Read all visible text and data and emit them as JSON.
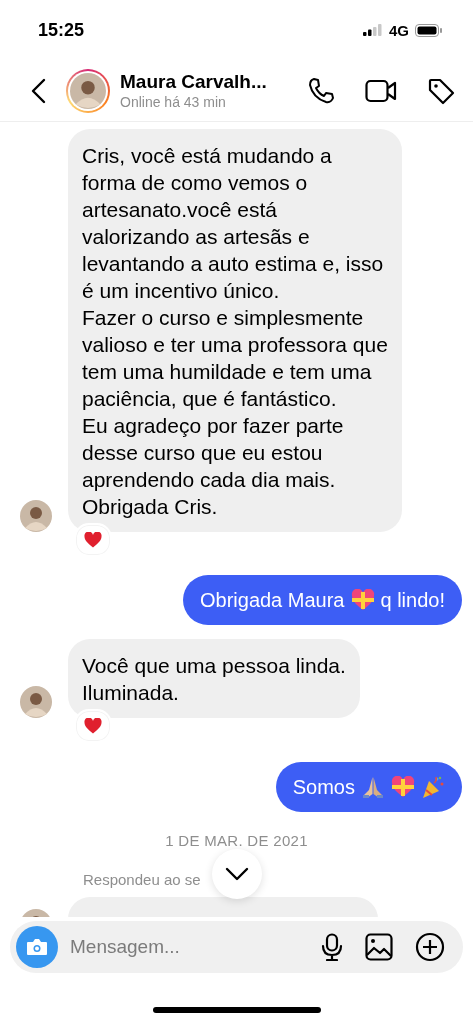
{
  "status_bar": {
    "time": "15:25",
    "network": "4G"
  },
  "header": {
    "name": "Maura Carvalh...",
    "presence": "Online há 43 min"
  },
  "messages": [
    {
      "kind": "incoming",
      "text": "Cris, você está mudando a forma de como vemos o artesanato.você está valorizando as artesãs e levantando a auto estima e, isso é um incentivo único.\nFazer o curso e simplesmente valioso e ter uma professora que tem uma humildade e tem uma paciência, que é fantástico.\nEu agradeço por fazer parte desse curso que eu estou aprendendo cada dia mais.\nObrigada Cris.",
      "reacted": true
    },
    {
      "kind": "outgoing",
      "parts": [
        {
          "kind": "text",
          "text": "Obrigada Maura"
        },
        {
          "kind": "gift-heart"
        },
        {
          "kind": "text",
          "text": "q lindo!"
        }
      ]
    },
    {
      "kind": "incoming",
      "text": "Você que uma pessoa linda.\nIluminada.",
      "reacted": true
    },
    {
      "kind": "outgoing",
      "parts": [
        {
          "kind": "text",
          "text": "Somos"
        },
        {
          "kind": "praying-hands"
        },
        {
          "kind": "gift-heart"
        },
        {
          "kind": "party-popper"
        }
      ]
    },
    {
      "kind": "date",
      "text": "1 DE MAR. DE 2021"
    },
    {
      "kind": "note",
      "text": "Respondeu ao se"
    },
    {
      "kind": "incoming_cut"
    }
  ],
  "composer": {
    "placeholder": "Mensagem..."
  }
}
